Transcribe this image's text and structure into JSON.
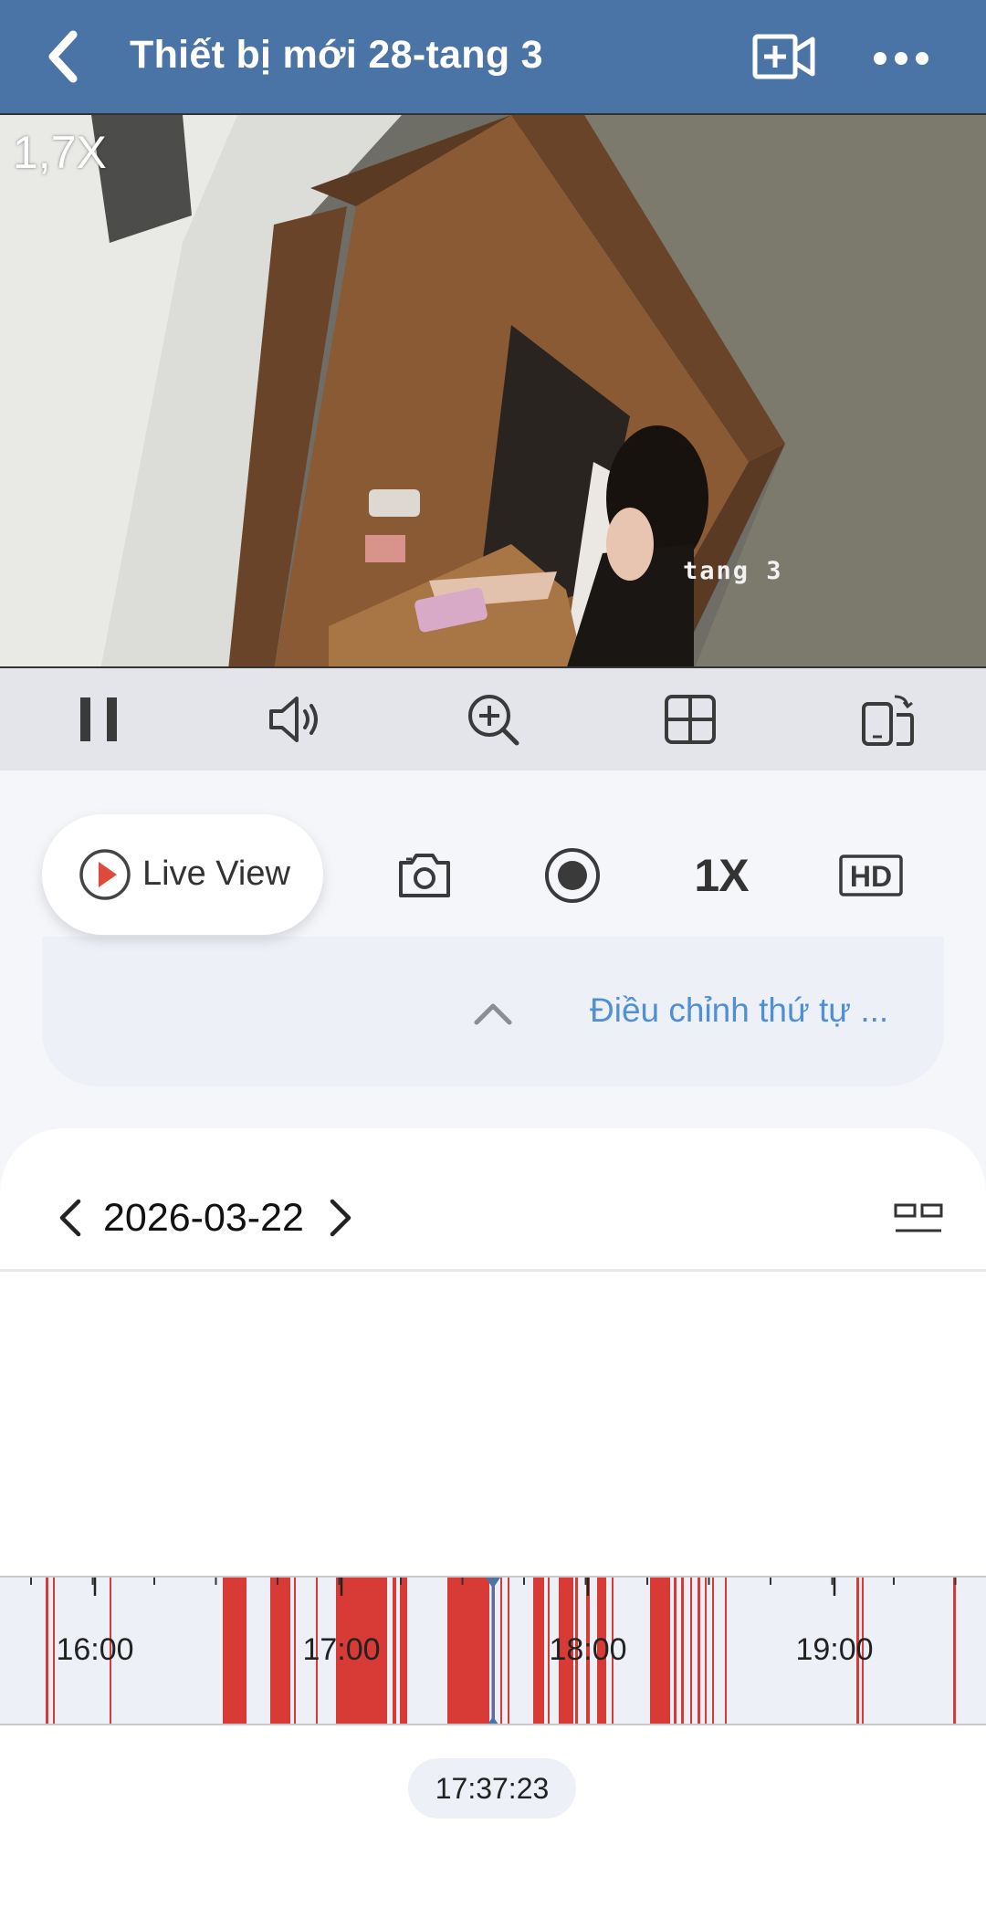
{
  "header": {
    "title": "Thiết bị mới 28-tang 3"
  },
  "video": {
    "zoom": "1,7X",
    "osd_text": "tang 3"
  },
  "controls": {
    "icons": [
      "pause-icon",
      "speaker-icon",
      "zoom-in-icon",
      "grid-icon",
      "rotate-screen-icon"
    ]
  },
  "actions": {
    "live_view_label": "Live View",
    "speed_label": "1X",
    "quality_label": "HD"
  },
  "adjust": {
    "link_text": "Điều chỉnh thứ tự ..."
  },
  "timeline": {
    "date": "2026-03-22",
    "hour_labels": [
      "16:00",
      "17:00",
      "18:00",
      "19:00"
    ],
    "current_time": "17:37:23",
    "colors": {
      "recording": "#d83a36",
      "cursor": "#4b74a6"
    }
  }
}
